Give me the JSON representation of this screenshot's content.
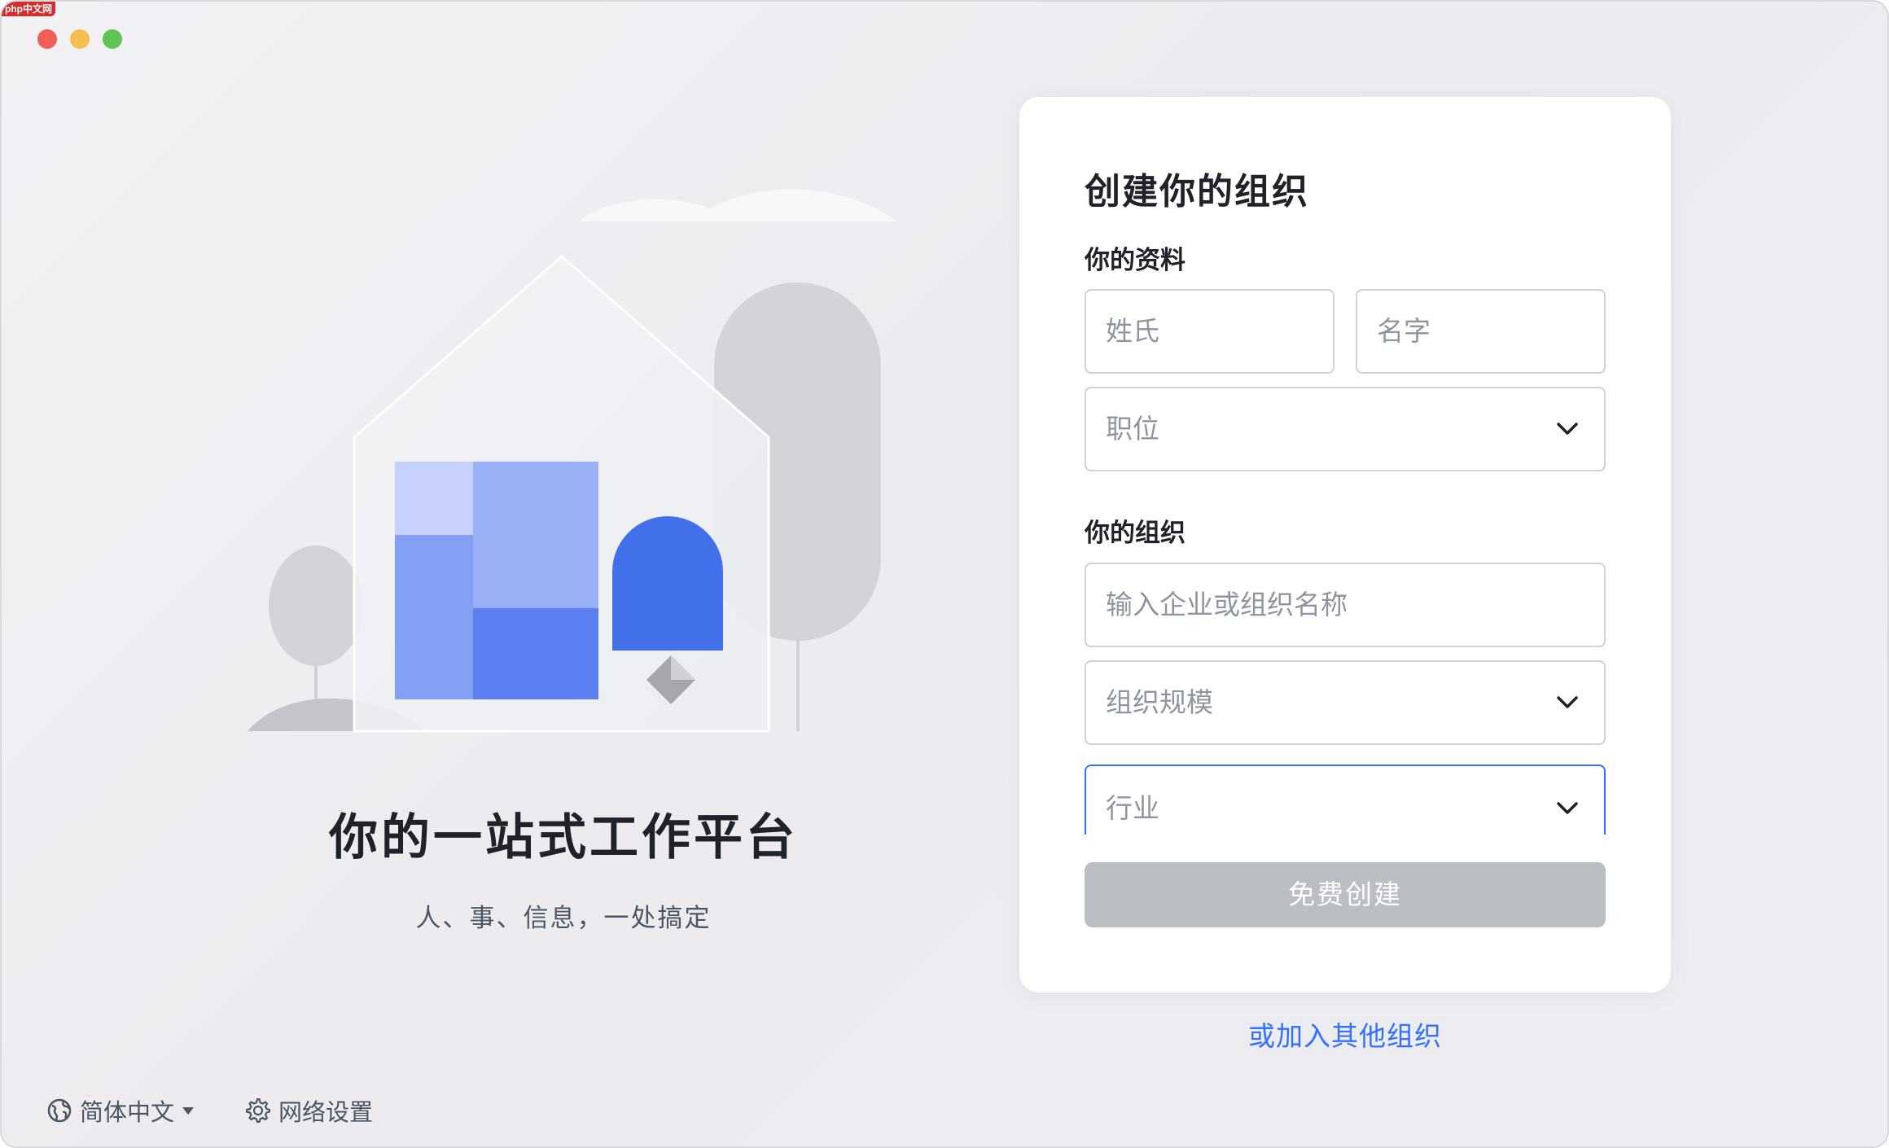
{
  "watermark": "php中文网",
  "window": {
    "controls": [
      "close",
      "minimize",
      "maximize"
    ]
  },
  "hero": {
    "title": "你的一站式工作平台",
    "subtitle": "人、事、信息，一处搞定"
  },
  "form": {
    "title": "创建你的组织",
    "profile_section": {
      "label": "你的资料",
      "last_name_placeholder": "姓氏",
      "first_name_placeholder": "名字",
      "position_placeholder": "职位"
    },
    "org_section": {
      "label": "你的组织",
      "org_name_placeholder": "输入企业或组织名称",
      "org_size_placeholder": "组织规模",
      "industry_placeholder": "行业"
    },
    "submit_label": "免费创建"
  },
  "join_link": "或加入其他组织",
  "footer": {
    "language": "简体中文",
    "network": "网络设置"
  },
  "colors": {
    "accent": "#3370ff",
    "button_disabled": "#bbbfc4",
    "text_primary": "#1f2329",
    "text_placeholder": "#8f959e"
  },
  "icons": [
    "globe-icon",
    "caret-down-icon",
    "gear-icon",
    "chevron-down-icon"
  ]
}
